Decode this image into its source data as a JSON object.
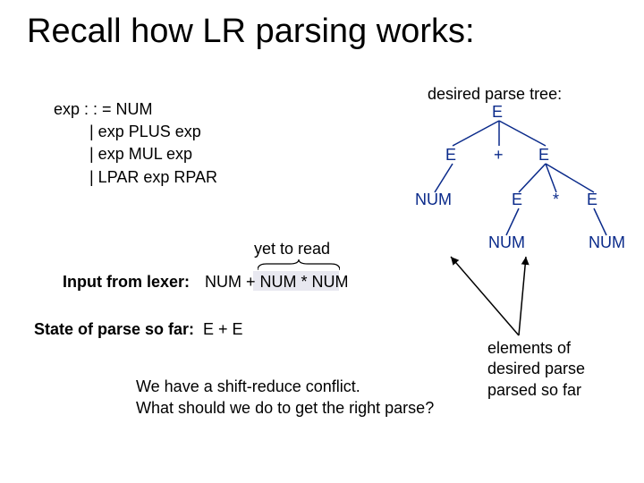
{
  "title": "Recall how LR parsing works:",
  "grammar": {
    "line1": "exp : : = NUM",
    "line2": "| exp PLUS exp",
    "line3": "| exp MUL exp",
    "line4": "| LPAR exp RPAR"
  },
  "desired_label": "desired parse tree:",
  "tree": {
    "root": "E",
    "l1_left": "E",
    "l1_mid": "+",
    "l1_right": "E",
    "l2_left": "NUM",
    "l2_r1": "E",
    "l2_r2": "*",
    "l2_r3": "E",
    "l3_left": "NUM",
    "l3_right": "NUM"
  },
  "yet_label": "yet to read",
  "input_label": "Input from lexer:",
  "input_value": "NUM + NUM * NUM",
  "state_label": "State of parse so far:",
  "state_value": "E + E",
  "conflict": {
    "line1": "We have a shift-reduce conflict.",
    "line2": "What should we do to get the right parse?"
  },
  "elements_note": {
    "line1": "elements of",
    "line2": "desired parse",
    "line3": "parsed so far"
  }
}
